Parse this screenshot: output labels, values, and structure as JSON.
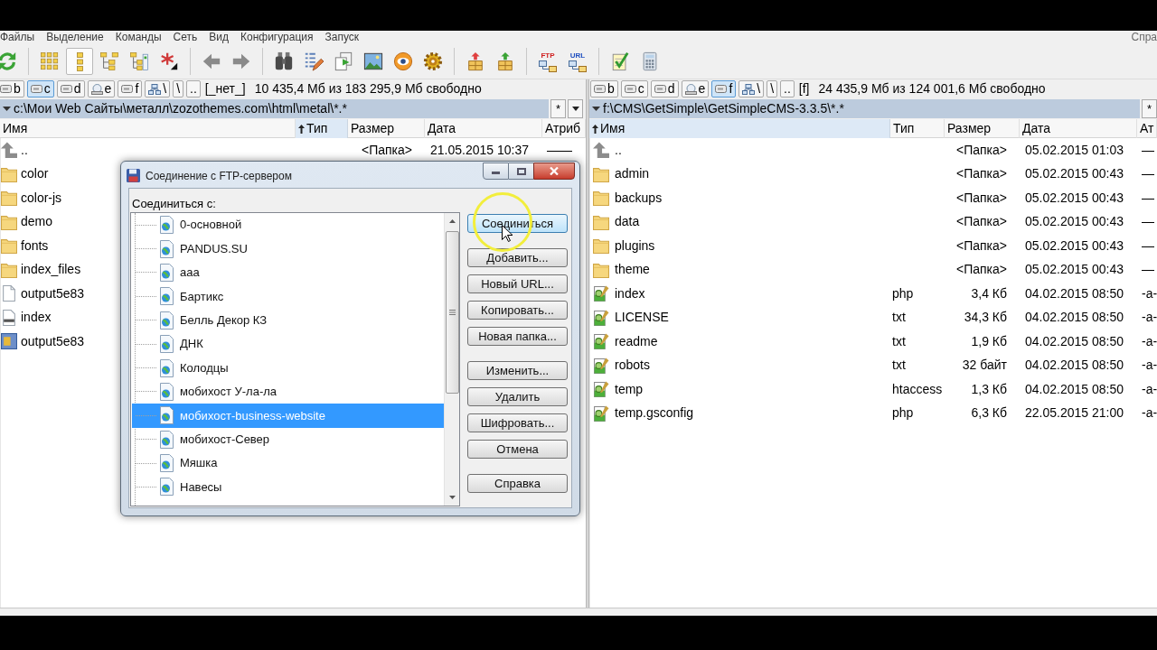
{
  "menu_bar": {
    "items": [
      "Файлы",
      "Выделение",
      "Команды",
      "Сеть",
      "Вид",
      "Конфигурация",
      "Запуск"
    ],
    "right_item": "Спра"
  },
  "toolbar": {
    "view_toggles": [
      {
        "selected": false
      },
      {
        "selected": true
      },
      {
        "selected": false
      },
      {
        "selected": false
      }
    ],
    "labelled_icons": [
      {
        "label": "FTP"
      },
      {
        "label": "URL"
      }
    ]
  },
  "panels": [
    {
      "drives": [
        {
          "label": "b",
          "kind": "hdd",
          "selected": false
        },
        {
          "label": "c",
          "kind": "hdd",
          "selected": true
        },
        {
          "label": "d",
          "kind": "hdd",
          "selected": false
        },
        {
          "label": "e",
          "kind": "removable",
          "selected": false
        },
        {
          "label": "f",
          "kind": "hdd",
          "selected": false
        },
        {
          "label": "\\",
          "kind": "network",
          "selected": false
        },
        {
          "label": "\\",
          "kind": "root",
          "selected": false
        },
        {
          "label": "..",
          "kind": "up",
          "selected": false
        }
      ],
      "drive_name": "[_нет_]",
      "free_space": "10 435,4 Мб из 183 295,9 Мб свободно",
      "path": "c:\\Мои Web Сайты\\металл\\zozothemes.com\\html\\metal\\*.*",
      "path_buttons": [
        {
          "kind": "text",
          "label": "*"
        },
        {
          "kind": "dropdown"
        }
      ],
      "columns": [
        {
          "label": "Имя",
          "sorted": false
        },
        {
          "label": "Тип",
          "sorted": true
        },
        {
          "label": "Размер",
          "sorted": false
        },
        {
          "label": "Дата",
          "sorted": false
        },
        {
          "label": "Атриб",
          "sorted": false
        }
      ],
      "rows": [
        {
          "name": "..",
          "kind": "up",
          "size": "<Папка>",
          "date": "21.05.2015 10:37",
          "attributes": "——"
        },
        {
          "name": "color",
          "kind": "folder"
        },
        {
          "name": "color-js",
          "kind": "folder"
        },
        {
          "name": "demo",
          "kind": "folder"
        },
        {
          "name": "fonts",
          "kind": "folder"
        },
        {
          "name": "index_files",
          "kind": "folder"
        },
        {
          "name": "output5e83",
          "kind": "file"
        },
        {
          "name": "index",
          "kind": "html"
        },
        {
          "name": "output5e83",
          "kind": "archive"
        }
      ]
    },
    {
      "drives": [
        {
          "label": "b",
          "kind": "hdd",
          "selected": false
        },
        {
          "label": "c",
          "kind": "hdd",
          "selected": false
        },
        {
          "label": "d",
          "kind": "hdd",
          "selected": false
        },
        {
          "label": "e",
          "kind": "removable",
          "selected": false
        },
        {
          "label": "f",
          "kind": "hdd",
          "selected": true
        },
        {
          "label": "\\",
          "kind": "network",
          "selected": false
        },
        {
          "label": "\\",
          "kind": "root",
          "selected": false
        },
        {
          "label": "..",
          "kind": "up",
          "selected": false
        }
      ],
      "drive_name": "[f]",
      "free_space": "24 435,9 Мб из 124 001,6 Мб свободно",
      "path": "f:\\CMS\\GetSimple\\GetSimpleCMS-3.3.5\\*.*",
      "path_buttons": [
        {
          "kind": "text",
          "label": "*"
        }
      ],
      "columns": [
        {
          "label": "Имя",
          "sorted": true
        },
        {
          "label": "Тип",
          "sorted": false
        },
        {
          "label": "Размер",
          "sorted": false
        },
        {
          "label": "Дата",
          "sorted": false
        },
        {
          "label": "Ат",
          "sorted": false
        }
      ],
      "rows": [
        {
          "name": "..",
          "kind": "up",
          "size": "<Папка>",
          "date": "05.02.2015 01:03",
          "attributes": "—"
        },
        {
          "name": "admin",
          "kind": "folder",
          "size": "<Папка>",
          "date": "05.02.2015 00:43",
          "attributes": "—"
        },
        {
          "name": "backups",
          "kind": "folder",
          "size": "<Папка>",
          "date": "05.02.2015 00:43",
          "attributes": "—"
        },
        {
          "name": "data",
          "kind": "folder",
          "size": "<Папка>",
          "date": "05.02.2015 00:43",
          "attributes": "—"
        },
        {
          "name": "plugins",
          "kind": "folder",
          "size": "<Папка>",
          "date": "05.02.2015 00:43",
          "attributes": "—"
        },
        {
          "name": "theme",
          "kind": "folder",
          "size": "<Папка>",
          "date": "05.02.2015 00:43",
          "attributes": "—"
        },
        {
          "name": "index",
          "kind": "script",
          "type": "php",
          "size": "3,4 Кб",
          "date": "04.02.2015 08:50",
          "attributes": "-a-"
        },
        {
          "name": "LICENSE",
          "kind": "script",
          "type": "txt",
          "size": "34,3 Кб",
          "date": "04.02.2015 08:50",
          "attributes": "-a-"
        },
        {
          "name": "readme",
          "kind": "script",
          "type": "txt",
          "size": "1,9 Кб",
          "date": "04.02.2015 08:50",
          "attributes": "-a-"
        },
        {
          "name": "robots",
          "kind": "script",
          "type": "txt",
          "size": "32 байт",
          "date": "04.02.2015 08:50",
          "attributes": "-a-"
        },
        {
          "name": "temp",
          "kind": "script",
          "type": "htaccess",
          "size": "1,3 Кб",
          "date": "04.02.2015 08:50",
          "attributes": "-a-"
        },
        {
          "name": "temp.gsconfig",
          "kind": "script",
          "type": "php",
          "size": "6,3 Кб",
          "date": "22.05.2015 21:00",
          "attributes": "-a-"
        }
      ]
    }
  ],
  "dialog": {
    "title": "Соединение с FTP-сервером",
    "label": "Соединиться с:",
    "items": [
      {
        "label": "0-основной",
        "selected": false
      },
      {
        "label": "PANDUS.SU",
        "selected": false
      },
      {
        "label": "aaa",
        "selected": false
      },
      {
        "label": "Бартикс",
        "selected": false
      },
      {
        "label": "Белль Декор КЗ",
        "selected": false
      },
      {
        "label": "ДНК",
        "selected": false
      },
      {
        "label": "Колодцы",
        "selected": false
      },
      {
        "label": "мобихост У-ла-ла",
        "selected": false
      },
      {
        "label": "мобихост-business-website",
        "selected": true
      },
      {
        "label": "мобихост-Север",
        "selected": false
      },
      {
        "label": "Мяшка",
        "selected": false
      },
      {
        "label": "Навесы",
        "selected": false
      }
    ],
    "button_groups": [
      [
        {
          "label": "Соединиться",
          "hovered": true
        }
      ],
      [
        {
          "label": "Добавить...",
          "hovered": false
        },
        {
          "label": "Новый URL...",
          "hovered": false
        },
        {
          "label": "Копировать...",
          "hovered": false
        },
        {
          "label": "Новая папка...",
          "hovered": false
        }
      ],
      [
        {
          "label": "Изменить...",
          "hovered": false
        },
        {
          "label": "Удалить",
          "hovered": false
        },
        {
          "label": "Шифровать...",
          "hovered": false
        },
        {
          "label": "Отмена",
          "hovered": false
        }
      ],
      [
        {
          "label": "Справка",
          "hovered": false
        }
      ]
    ]
  }
}
